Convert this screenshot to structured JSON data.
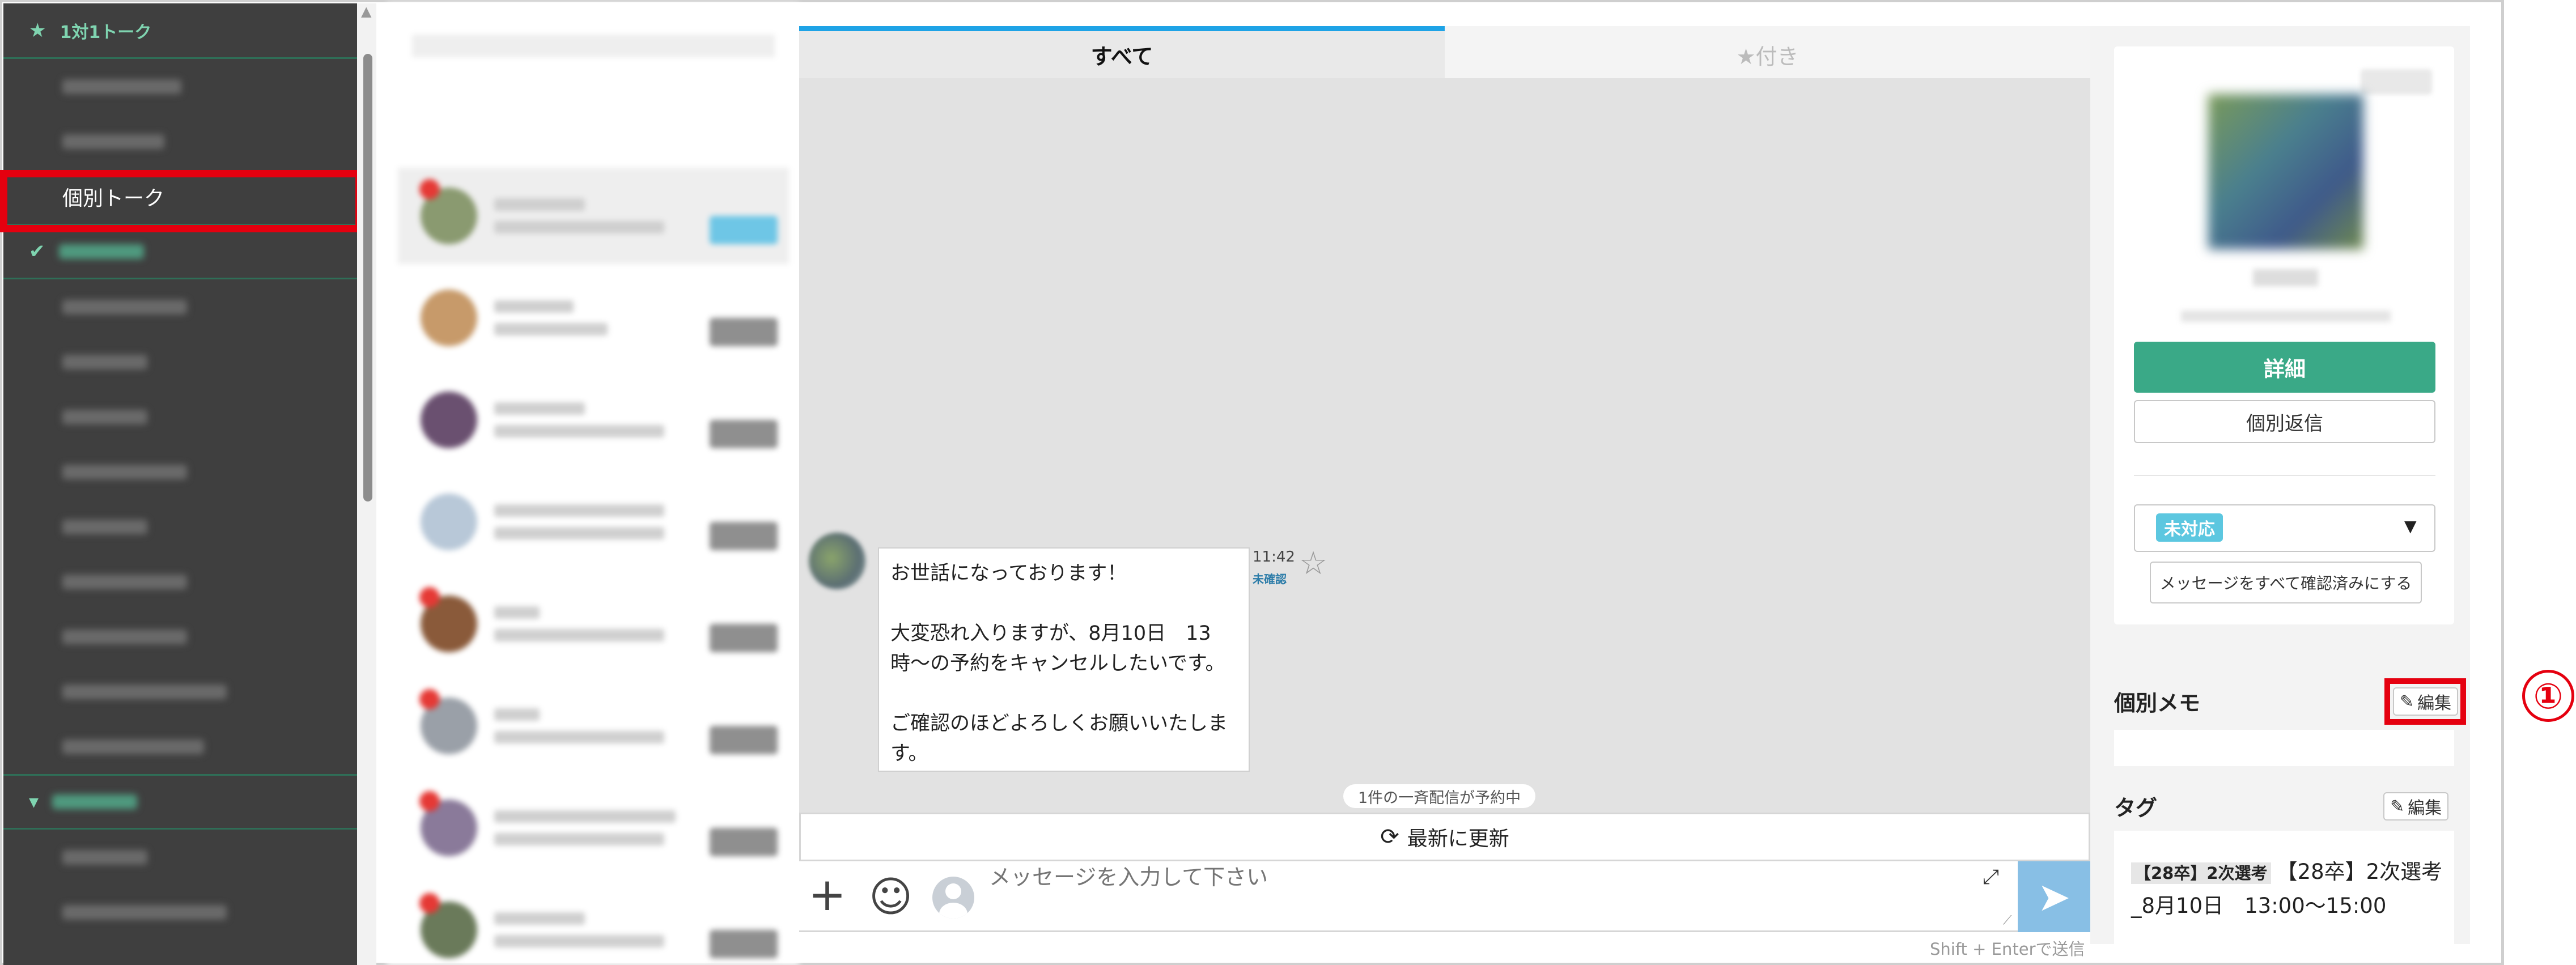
{
  "sidebar": {
    "sections": [
      {
        "label": "1対1トーク",
        "icon": "star-icon"
      },
      {
        "label": "",
        "icon": "check-icon"
      },
      {
        "label": "",
        "icon": "chevron-down-icon"
      }
    ],
    "active_item": "個別トーク"
  },
  "chat": {
    "tabs": [
      {
        "label": "すべて",
        "active": true
      },
      {
        "label": "★付き",
        "active": false
      }
    ],
    "message": {
      "text": "お世話になっております！\n\n大変恐れ入りますが、8月10日　13時〜の予約をキャンセルしたいです。\n\nご確認のほどよろしくお願いいたします。",
      "time": "11:42",
      "status": "未確認"
    },
    "broadcast_notice": "1件の一斉配信が予約中",
    "refresh_label": "最新に更新",
    "input_placeholder": "メッセージを入力して下さい",
    "send_hint": "Shift + Enterで送信"
  },
  "profile": {
    "detail_button": "詳細",
    "reply_button": "個別返信",
    "status_badge": "未対応",
    "confirm_all_button": "メッセージをすべて確認済みにする"
  },
  "memo": {
    "title": "個別メモ",
    "edit_label": "編集",
    "annotation": "①"
  },
  "tags": {
    "title": "タグ",
    "edit_label": "編集",
    "chip": "【28卒】2次選考",
    "text": "【28卒】2次選考_8月10日　13:00〜15:00"
  },
  "colors": {
    "sidebar_bg": "#3f3f3f",
    "accent_green": "#3aa987",
    "tab_active_border": "#1ea3e6",
    "highlight_red": "#e5000f",
    "status_badge": "#5cc7e0",
    "send_button": "#88bfe5"
  }
}
